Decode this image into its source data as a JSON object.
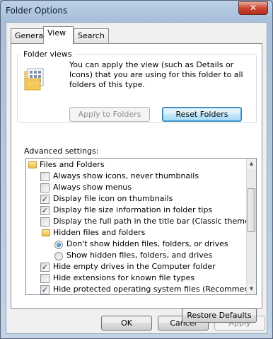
{
  "window": {
    "title": "Folder Options",
    "close_glyph": "✕"
  },
  "tabs": [
    {
      "label": "General"
    },
    {
      "label": "View"
    },
    {
      "label": "Search"
    }
  ],
  "folder_views": {
    "legend": "Folder views",
    "description": "You can apply the view (such as Details or Icons) that you are using for this folder to all folders of this type.",
    "apply_button": "Apply to Folders",
    "reset_button": "Reset Folders"
  },
  "advanced": {
    "label": "Advanced settings:",
    "items": [
      {
        "kind": "folder",
        "label": "Files and Folders"
      },
      {
        "kind": "checkbox",
        "checked": false,
        "label": "Always show icons, never thumbnails"
      },
      {
        "kind": "checkbox",
        "checked": false,
        "label": "Always show menus"
      },
      {
        "kind": "checkbox",
        "checked": true,
        "label": "Display file icon on thumbnails"
      },
      {
        "kind": "checkbox",
        "checked": true,
        "label": "Display file size information in folder tips"
      },
      {
        "kind": "checkbox",
        "checked": false,
        "label": "Display the full path in the title bar (Classic theme only)"
      },
      {
        "kind": "folder",
        "label": "Hidden files and folders"
      },
      {
        "kind": "radio",
        "checked": true,
        "label": "Don't show hidden files, folders, or drives"
      },
      {
        "kind": "radio",
        "checked": false,
        "label": "Show hidden files, folders, and drives"
      },
      {
        "kind": "checkbox",
        "checked": true,
        "label": "Hide empty drives in the Computer folder"
      },
      {
        "kind": "checkbox",
        "checked": false,
        "label": "Hide extensions for known file types"
      },
      {
        "kind": "checkbox",
        "checked": true,
        "label": "Hide protected operating system files (Recommended)"
      }
    ]
  },
  "restore_button": "Restore Defaults",
  "footer": {
    "ok": "OK",
    "cancel": "Cancel",
    "apply": "Apply"
  },
  "colors": {
    "check": "#21436a",
    "focus_border": "#3c7fb1",
    "titlebar": "#bcd0e6"
  }
}
